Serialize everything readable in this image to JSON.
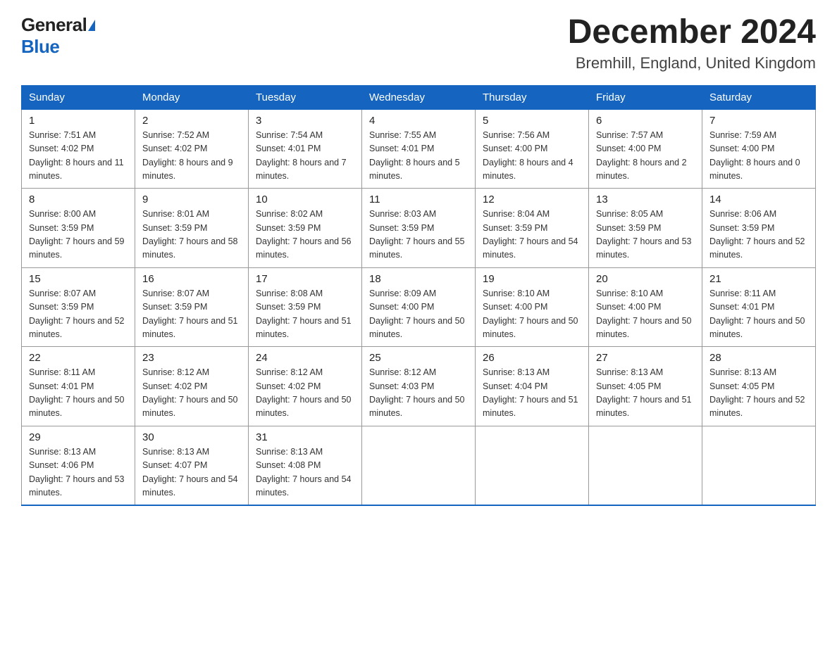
{
  "header": {
    "logo_general": "General",
    "logo_blue": "Blue",
    "month_title": "December 2024",
    "location": "Bremhill, England, United Kingdom"
  },
  "days_of_week": [
    "Sunday",
    "Monday",
    "Tuesday",
    "Wednesday",
    "Thursday",
    "Friday",
    "Saturday"
  ],
  "weeks": [
    [
      {
        "day": "1",
        "sunrise": "7:51 AM",
        "sunset": "4:02 PM",
        "daylight": "8 hours and 11 minutes."
      },
      {
        "day": "2",
        "sunrise": "7:52 AM",
        "sunset": "4:02 PM",
        "daylight": "8 hours and 9 minutes."
      },
      {
        "day": "3",
        "sunrise": "7:54 AM",
        "sunset": "4:01 PM",
        "daylight": "8 hours and 7 minutes."
      },
      {
        "day": "4",
        "sunrise": "7:55 AM",
        "sunset": "4:01 PM",
        "daylight": "8 hours and 5 minutes."
      },
      {
        "day": "5",
        "sunrise": "7:56 AM",
        "sunset": "4:00 PM",
        "daylight": "8 hours and 4 minutes."
      },
      {
        "day": "6",
        "sunrise": "7:57 AM",
        "sunset": "4:00 PM",
        "daylight": "8 hours and 2 minutes."
      },
      {
        "day": "7",
        "sunrise": "7:59 AM",
        "sunset": "4:00 PM",
        "daylight": "8 hours and 0 minutes."
      }
    ],
    [
      {
        "day": "8",
        "sunrise": "8:00 AM",
        "sunset": "3:59 PM",
        "daylight": "7 hours and 59 minutes."
      },
      {
        "day": "9",
        "sunrise": "8:01 AM",
        "sunset": "3:59 PM",
        "daylight": "7 hours and 58 minutes."
      },
      {
        "day": "10",
        "sunrise": "8:02 AM",
        "sunset": "3:59 PM",
        "daylight": "7 hours and 56 minutes."
      },
      {
        "day": "11",
        "sunrise": "8:03 AM",
        "sunset": "3:59 PM",
        "daylight": "7 hours and 55 minutes."
      },
      {
        "day": "12",
        "sunrise": "8:04 AM",
        "sunset": "3:59 PM",
        "daylight": "7 hours and 54 minutes."
      },
      {
        "day": "13",
        "sunrise": "8:05 AM",
        "sunset": "3:59 PM",
        "daylight": "7 hours and 53 minutes."
      },
      {
        "day": "14",
        "sunrise": "8:06 AM",
        "sunset": "3:59 PM",
        "daylight": "7 hours and 52 minutes."
      }
    ],
    [
      {
        "day": "15",
        "sunrise": "8:07 AM",
        "sunset": "3:59 PM",
        "daylight": "7 hours and 52 minutes."
      },
      {
        "day": "16",
        "sunrise": "8:07 AM",
        "sunset": "3:59 PM",
        "daylight": "7 hours and 51 minutes."
      },
      {
        "day": "17",
        "sunrise": "8:08 AM",
        "sunset": "3:59 PM",
        "daylight": "7 hours and 51 minutes."
      },
      {
        "day": "18",
        "sunrise": "8:09 AM",
        "sunset": "4:00 PM",
        "daylight": "7 hours and 50 minutes."
      },
      {
        "day": "19",
        "sunrise": "8:10 AM",
        "sunset": "4:00 PM",
        "daylight": "7 hours and 50 minutes."
      },
      {
        "day": "20",
        "sunrise": "8:10 AM",
        "sunset": "4:00 PM",
        "daylight": "7 hours and 50 minutes."
      },
      {
        "day": "21",
        "sunrise": "8:11 AM",
        "sunset": "4:01 PM",
        "daylight": "7 hours and 50 minutes."
      }
    ],
    [
      {
        "day": "22",
        "sunrise": "8:11 AM",
        "sunset": "4:01 PM",
        "daylight": "7 hours and 50 minutes."
      },
      {
        "day": "23",
        "sunrise": "8:12 AM",
        "sunset": "4:02 PM",
        "daylight": "7 hours and 50 minutes."
      },
      {
        "day": "24",
        "sunrise": "8:12 AM",
        "sunset": "4:02 PM",
        "daylight": "7 hours and 50 minutes."
      },
      {
        "day": "25",
        "sunrise": "8:12 AM",
        "sunset": "4:03 PM",
        "daylight": "7 hours and 50 minutes."
      },
      {
        "day": "26",
        "sunrise": "8:13 AM",
        "sunset": "4:04 PM",
        "daylight": "7 hours and 51 minutes."
      },
      {
        "day": "27",
        "sunrise": "8:13 AM",
        "sunset": "4:05 PM",
        "daylight": "7 hours and 51 minutes."
      },
      {
        "day": "28",
        "sunrise": "8:13 AM",
        "sunset": "4:05 PM",
        "daylight": "7 hours and 52 minutes."
      }
    ],
    [
      {
        "day": "29",
        "sunrise": "8:13 AM",
        "sunset": "4:06 PM",
        "daylight": "7 hours and 53 minutes."
      },
      {
        "day": "30",
        "sunrise": "8:13 AM",
        "sunset": "4:07 PM",
        "daylight": "7 hours and 54 minutes."
      },
      {
        "day": "31",
        "sunrise": "8:13 AM",
        "sunset": "4:08 PM",
        "daylight": "7 hours and 54 minutes."
      },
      null,
      null,
      null,
      null
    ]
  ]
}
